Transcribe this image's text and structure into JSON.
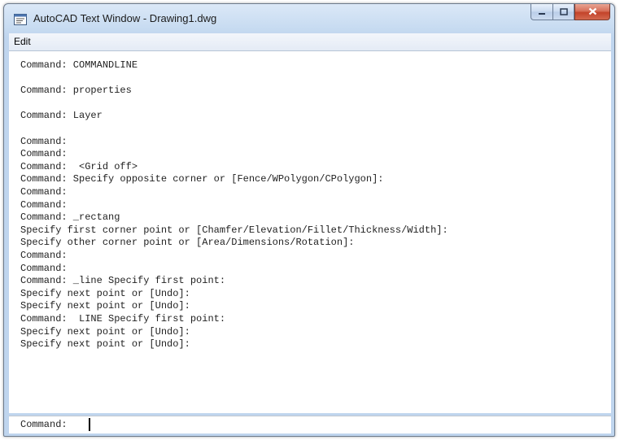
{
  "window": {
    "title": "AutoCAD Text Window - Drawing1.dwg",
    "app_icon": "autocad-text-window-icon"
  },
  "caption_buttons": {
    "minimize_icon": "minimize-icon",
    "maximize_icon": "maximize-icon",
    "close_icon": "close-icon"
  },
  "menu": {
    "items": [
      {
        "label": "Edit"
      }
    ]
  },
  "history": {
    "lines": [
      "Command: COMMANDLINE",
      "",
      "Command: properties",
      "",
      "Command: Layer",
      "",
      "Command:",
      "Command:",
      "Command:  <Grid off>",
      "Command: Specify opposite corner or [Fence/WPolygon/CPolygon]:",
      "Command:",
      "Command:",
      "Command: _rectang",
      "Specify first corner point or [Chamfer/Elevation/Fillet/Thickness/Width]:",
      "Specify other corner point or [Area/Dimensions/Rotation]:",
      "Command:",
      "Command:",
      "Command: _line Specify first point:",
      "Specify next point or [Undo]:",
      "Specify next point or [Undo]:",
      "Command:  LINE Specify first point:",
      "Specify next point or [Undo]:",
      "Specify next point or [Undo]:"
    ]
  },
  "command_line": {
    "prompt": "Command:",
    "value": ""
  },
  "colors": {
    "close_button": "#c3432a",
    "title_bar": "#c7dbf1",
    "text": "#222222"
  }
}
